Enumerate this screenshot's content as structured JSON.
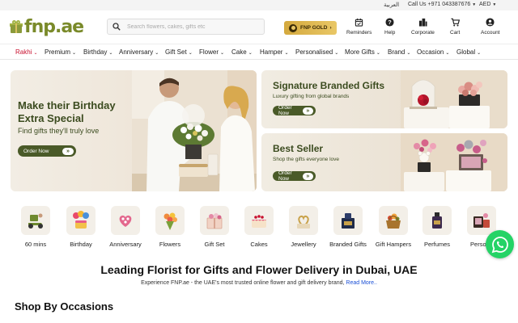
{
  "topbar": {
    "language": "العربية",
    "call": "Call Us +971 043387676",
    "currency": "AED"
  },
  "header": {
    "logo_text": "fnp.ae",
    "search_placeholder": "Search flowers, cakes, gifts etc",
    "gold_label": "FNP GOLD",
    "gold_arrow": "›",
    "nav": [
      {
        "label": "Reminders",
        "icon": "calendar-icon"
      },
      {
        "label": "Help",
        "icon": "help-icon"
      },
      {
        "label": "Corporate",
        "icon": "building-icon"
      },
      {
        "label": "Cart",
        "icon": "cart-icon"
      },
      {
        "label": "Account",
        "icon": "account-icon"
      }
    ]
  },
  "categories_nav": [
    {
      "label": "Rakhi",
      "active": true
    },
    {
      "label": "Premium"
    },
    {
      "label": "Birthday"
    },
    {
      "label": "Anniversary"
    },
    {
      "label": "Gift Set"
    },
    {
      "label": "Flower"
    },
    {
      "label": "Cake"
    },
    {
      "label": "Hamper"
    },
    {
      "label": "Personalised"
    },
    {
      "label": "More Gifts"
    },
    {
      "label": "Brand"
    },
    {
      "label": "Occasion"
    },
    {
      "label": "Global"
    }
  ],
  "banners": {
    "main": {
      "title_line1": "Make their Birthday",
      "title_line2": "Extra Special",
      "subtitle": "Find gifts they'll truly love",
      "button": "Order Now"
    },
    "signature": {
      "title": "Signature Branded Gifts",
      "subtitle": "Luxury gifting from global brands",
      "button": "Order Now"
    },
    "bestseller": {
      "title": "Best Seller",
      "subtitle": "Shop the gifts everyone love",
      "button": "Order Now"
    }
  },
  "category_tiles": [
    {
      "label": "60 mins",
      "icon": "scooter-icon"
    },
    {
      "label": "Birthday",
      "icon": "birthday-cake-icon"
    },
    {
      "label": "Anniversary",
      "icon": "anniversary-cake-icon"
    },
    {
      "label": "Flowers",
      "icon": "bouquet-icon"
    },
    {
      "label": "Gift Set",
      "icon": "gift-set-icon"
    },
    {
      "label": "Cakes",
      "icon": "cake-icon"
    },
    {
      "label": "Jewellery",
      "icon": "jewellery-icon"
    },
    {
      "label": "Branded Gifts",
      "icon": "branded-gift-icon"
    },
    {
      "label": "Gift Hampers",
      "icon": "hamper-icon"
    },
    {
      "label": "Perfumes",
      "icon": "perfume-icon"
    },
    {
      "label": "Persona",
      "icon": "personalised-icon"
    }
  ],
  "content": {
    "heading": "Leading Florist for Gifts and Flower Delivery in Dubai, UAE",
    "description": "Experience FNP.ae - the UAE's most trusted online flower and gift delivery brand, ",
    "read_more": "Read More..",
    "section_title": "Shop By Occasions"
  },
  "colors": {
    "brand_green": "#7a8a2a",
    "accent_red": "#c8102e",
    "button_green": "#4a5a28",
    "gold": "#e9c766",
    "whatsapp": "#25d366"
  }
}
